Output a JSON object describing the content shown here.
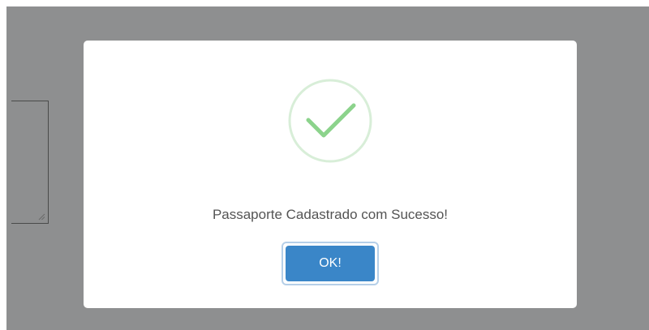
{
  "dialog": {
    "message": "Passaporte Cadastrado com Sucesso!",
    "ok_label": "OK!",
    "icon": "success-check-icon"
  },
  "colors": {
    "overlay": "#8e8f90",
    "check": "#8cd38c",
    "check_ring": "#d8eed8",
    "button": "#3a86c8",
    "message_text": "#545454"
  }
}
